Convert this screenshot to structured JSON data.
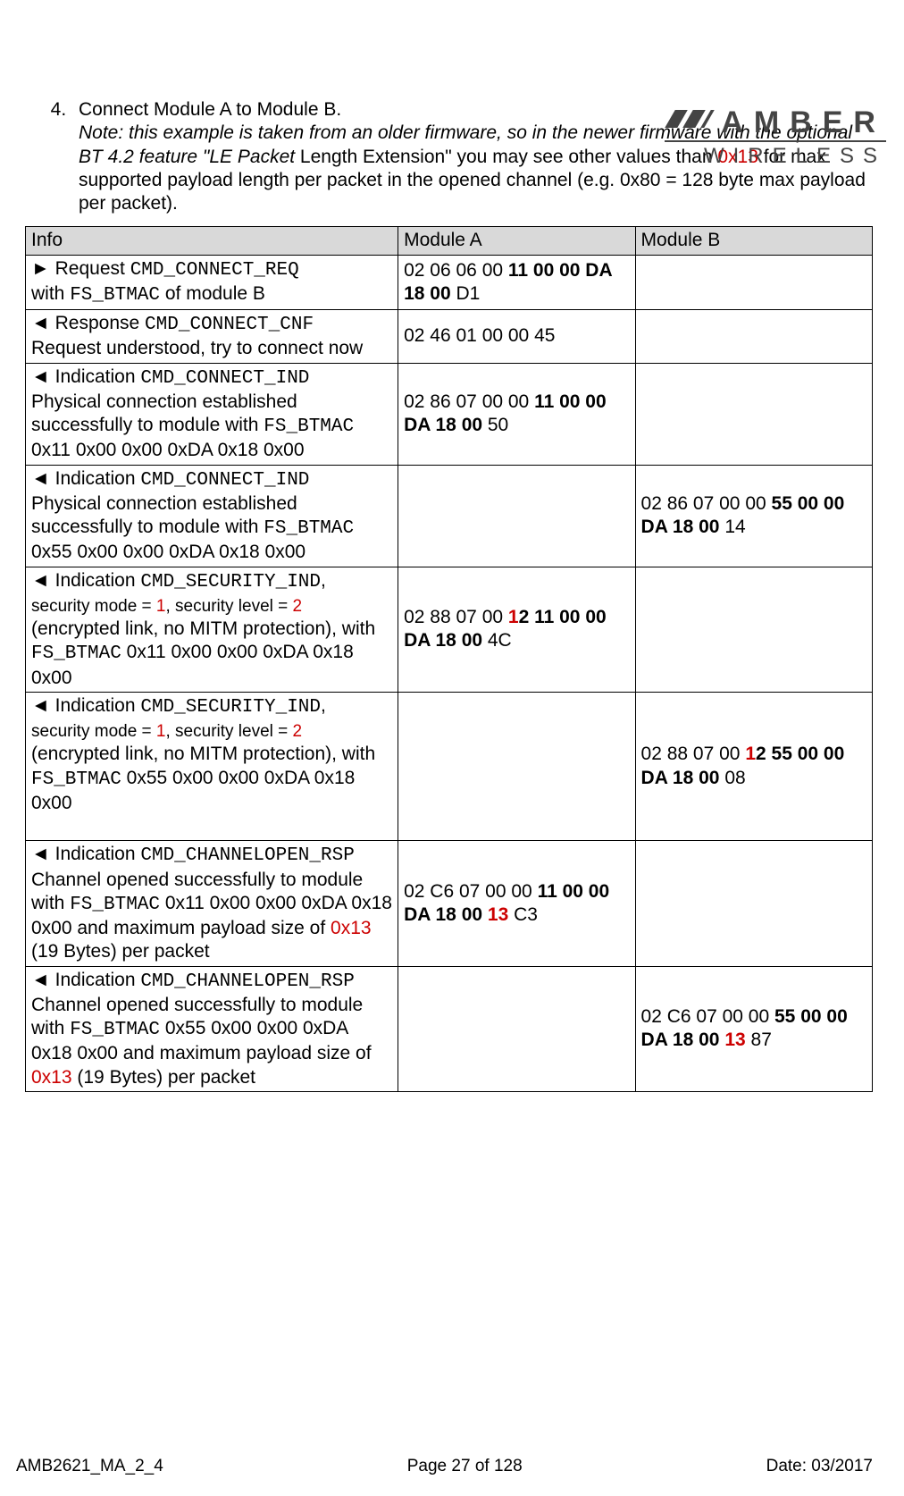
{
  "logo": {
    "top": "AMBER",
    "bottom": "WIRELESS"
  },
  "list": {
    "num": "4.",
    "line1": "Connect Module A to Module B.",
    "note_i1": "Note: this example is taken from an older firmware, so in the newer firmware with the optional BT 4.2 feature \"LE Packet ",
    "note_p1": "Length Extension\" you may see other values than ",
    "hex1": "0x13",
    "note_p2": " for max supported payload length per packet in the opened channel (e.g. 0x80 = 128 byte max payload per packet)."
  },
  "headers": {
    "h1": "Info",
    "h2": "Module A",
    "h3": "Module B"
  },
  "rows": [
    {
      "info": {
        "arrow": "►",
        "t1": " Request ",
        "cmd": "CMD_CONNECT_REQ",
        "br": true,
        "t2": "with ",
        "mono2": "FS_BTMAC",
        "t3": " of module B"
      },
      "a": {
        "pre": "02 06 06 00 ",
        "bold": "11 00 00 DA 18 00",
        "post": " D1"
      },
      "b": {}
    },
    {
      "info": {
        "arrow": "◄",
        "t1": " Response ",
        "cmd": "CMD_CONNECT_CNF",
        "br": true,
        "t2": "Request understood, try to connect now"
      },
      "a": {
        "pre": "02 46 01 00 00 45"
      },
      "b": {}
    },
    {
      "info": {
        "arrow": "◄",
        "t1": " Indication ",
        "cmd": "CMD_CONNECT_IND",
        "br": true,
        "t2": "Physical connection established successfully to module with ",
        "mono2": "FS_BTMAC",
        "t3": " 0x11 0x00 0x00 0xDA 0x18 0x00"
      },
      "a": {
        "pre": "02 86 07 00 00 ",
        "bold": "11 00 00 DA 18 00",
        "post": " 50"
      },
      "b": {}
    },
    {
      "info": {
        "arrow": "◄",
        "t1": " Indication ",
        "cmd": "CMD_CONNECT_IND",
        "br": true,
        "t2": "Physical connection established successfully to module with ",
        "mono2": "FS_BTMAC",
        "t3": " 0x55 0x00 0x00 0xDA 0x18 0x00"
      },
      "a": {},
      "b": {
        "pre": "02 86 07 00 00 ",
        "bold": "55 00 00 DA 18 00",
        "post": " 14"
      }
    },
    {
      "info": {
        "arrow": "◄",
        "t1": " Indication ",
        "cmd": "CMD_SECURITY_IND",
        "after_cmd": ",",
        "br": true,
        "sm_pre": "security mode = ",
        "sm_red1": "1",
        "sm_mid": ", security level = ",
        "sm_red2": "2",
        "t2": " (encrypted link, no MITM protection), with ",
        "mono2": "FS_BTMAC",
        "t3": " 0x11 0x00 0x00 0xDA 0x18 0x00"
      },
      "a": {
        "pre": "02 88 07 00 ",
        "redb": "1",
        "midb": "2 11 00 00 DA 18 00",
        "post": " 4C"
      },
      "b": {}
    },
    {
      "info": {
        "arrow": "◄",
        "t1": " Indication ",
        "cmd": "CMD_SECURITY_IND",
        "after_cmd": ",",
        "br": true,
        "sm_pre": "security mode = ",
        "sm_red1": "1",
        "sm_mid": ", security level = ",
        "sm_red2": "2",
        "t2": " (encrypted link, no MITM protection), with ",
        "mono2": "FS_BTMAC",
        "t3": " 0x55 0x00 0x00 0xDA 0x18 0x00",
        "extra_br": true
      },
      "a": {},
      "b": {
        "pre": "02 88 07 00 ",
        "redb": "1",
        "midb": "2 55 00 00 DA 18 00",
        "post": " 08"
      }
    },
    {
      "info": {
        "arrow": "◄",
        "t1": " Indication ",
        "cmd": "CMD_CHANNELOPEN_RSP",
        "br": true,
        "t2": "Channel opened successfully to module with ",
        "mono2": "FS_BTMAC",
        "t3": " 0x11 0x00 0x00 0xDA 0x18 0x00 and maximum payload size of ",
        "red_tail": "0x13",
        "t4": " (19 Bytes) per packet"
      },
      "a": {
        "pre": "02 C6 07 00 00 ",
        "bold": "11 00 00 DA 18 00 ",
        "redb_plain": "13",
        "post": " C3"
      },
      "b": {}
    },
    {
      "info": {
        "arrow": "◄",
        "t1": " Indication ",
        "cmd": "CMD_CHANNELOPEN_RSP",
        "br": true,
        "t2": "Channel opened successfully to module with ",
        "mono2": "FS_BTMAC",
        "t3": " 0x55 0x00 0x00 0xDA 0x18 0x00 and maximum payload size of ",
        "red_tail": "0x13",
        "t4": " (19 Bytes) per packet"
      },
      "a": {},
      "b": {
        "pre": "02 C6 07 00 00 ",
        "bold": "55 00 00 DA 18 00 ",
        "redb_plain": "13",
        "post": " 87"
      }
    }
  ],
  "footer": {
    "left": "AMB2621_MA_2_4",
    "center": "Page 27 of 128",
    "right": "Date: 03/2017"
  }
}
